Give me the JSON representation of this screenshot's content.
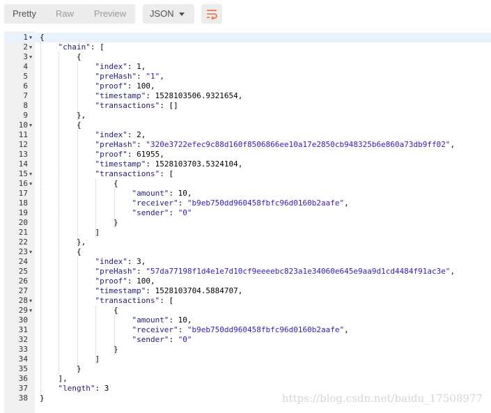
{
  "toolbar": {
    "view_modes": [
      "Pretty",
      "Raw",
      "Preview"
    ],
    "active_mode": "Pretty",
    "format_label": "JSON",
    "wrap_icon": "wrap-lines-icon",
    "accent": "#f26b3a"
  },
  "editor": {
    "lines": [
      "{",
      "    \"chain\": [",
      "        {",
      "            \"index\": 1,",
      "            \"preHash\": \"1\",",
      "            \"proof\": 100,",
      "            \"timestamp\": 1528103506.9321654,",
      "            \"transactions\": []",
      "        },",
      "        {",
      "            \"index\": 2,",
      "            \"preHash\": \"320e3722efec9c88d160f8506866ee10a17e2850cb948325b6e860a73db9ff02\",",
      "            \"proof\": 61955,",
      "            \"timestamp\": 1528103703.5324104,",
      "            \"transactions\": [",
      "                {",
      "                    \"amount\": 10,",
      "                    \"receiver\": \"b9eb750dd960458fbfc96d0160b2aafe\",",
      "                    \"sender\": \"0\"",
      "                }",
      "            ]",
      "        },",
      "        {",
      "            \"index\": 3,",
      "            \"preHash\": \"57da77198f1d4e1e7d10cf9eeeebc823a1e34060e645e9aa9d1cd4484f91ac3e\",",
      "            \"proof\": 100,",
      "            \"timestamp\": 1528103704.5884707,",
      "            \"transactions\": [",
      "                {",
      "                    \"amount\": 10,",
      "                    \"receiver\": \"b9eb750dd960458fbfc96d0160b2aafe\",",
      "                    \"sender\": \"0\"",
      "                }",
      "            ]",
      "        }",
      "    ],",
      "    \"length\": 3",
      "}"
    ],
    "fold_lines": [
      1,
      2,
      3,
      10,
      15,
      16,
      23,
      28,
      29
    ],
    "active_line": 1
  },
  "watermark": "https://blog.csdn.net/baidu_17508977"
}
